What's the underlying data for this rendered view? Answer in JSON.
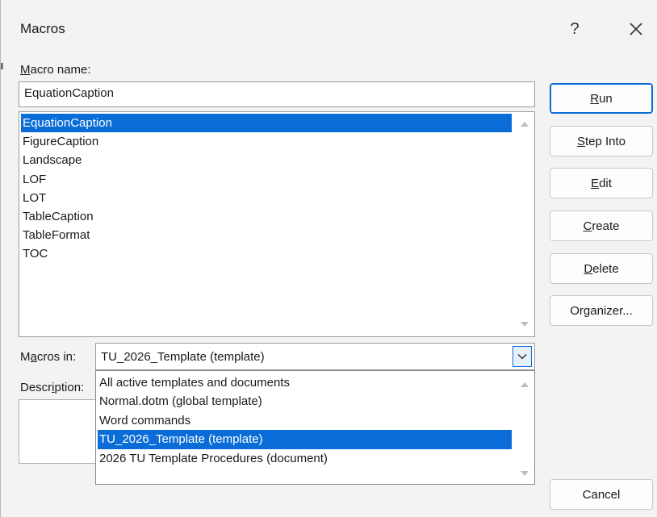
{
  "window": {
    "title": "Macros",
    "help_glyph": "?"
  },
  "macro_name": {
    "label_prefix": "M",
    "label_rest": "acro name:",
    "value": "EquationCaption"
  },
  "macros": {
    "items": [
      "EquationCaption",
      "FigureCaption",
      "Landscape",
      "LOF",
      "LOT",
      "TableCaption",
      "TableFormat",
      "TOC"
    ],
    "selected": "EquationCaption"
  },
  "buttons": {
    "run": {
      "mnemonic": "R",
      "rest": "un"
    },
    "step_into": {
      "mnemonic": "S",
      "rest": "tep Into"
    },
    "edit": {
      "mnemonic": "E",
      "rest": "dit"
    },
    "create": {
      "mnemonic": "C",
      "rest": "reate"
    },
    "delete": {
      "mnemonic": "D",
      "rest": "elete"
    },
    "organizer": {
      "before": "Or",
      "mnemonic": "g",
      "rest": "anizer..."
    },
    "cancel": "Cancel"
  },
  "macros_in": {
    "label_before": "M",
    "label_mnemonic": "a",
    "label_rest": "cros in:",
    "value": "TU_2026_Template (template)",
    "options": [
      "All active templates and documents",
      "Normal.dotm (global template)",
      "Word commands",
      "TU_2026_Template (template)",
      "2026 TU Template Procedures (document)"
    ],
    "selected": "TU_2026_Template (template)"
  },
  "description": {
    "label_before": "Descr",
    "label_mnemonic": "i",
    "label_rest": "ption:"
  },
  "colors": {
    "selection": "#0a6cd6",
    "dialog_bg": "#f3f3f3"
  },
  "icons": {
    "close": "close-icon",
    "scroll_up": "scroll-up-arrow-icon",
    "scroll_down": "scroll-down-arrow-icon",
    "dropdown": "chevron-down-icon"
  }
}
